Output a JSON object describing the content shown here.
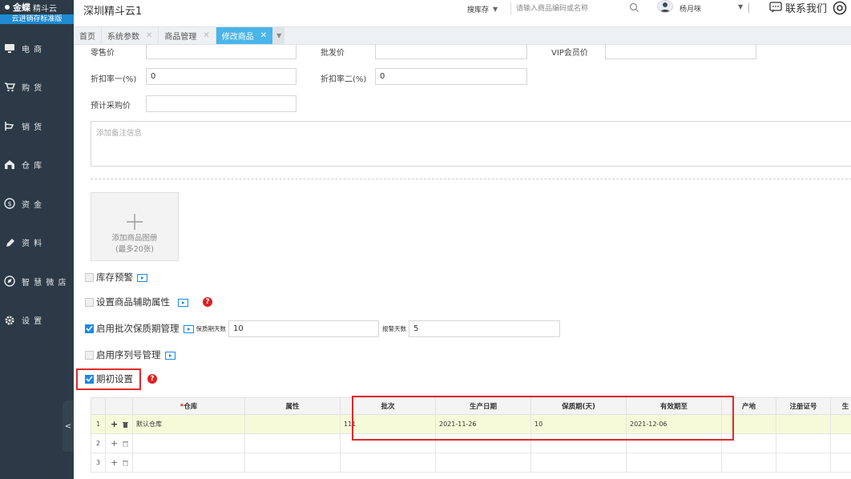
{
  "sidebar": {
    "brand": "金蝶",
    "brand_sub": "精斗云",
    "edition": "云进销存标准版",
    "items": [
      {
        "label": "电 商",
        "icon": "computer-icon"
      },
      {
        "label": "购 货",
        "icon": "cart-icon"
      },
      {
        "label": "销 货",
        "icon": "sales-icon"
      },
      {
        "label": "仓 库",
        "icon": "warehouse-icon"
      },
      {
        "label": "资 金",
        "icon": "money-icon"
      },
      {
        "label": "资 料",
        "icon": "pen-icon"
      },
      {
        "label": "智 慧 微 店",
        "icon": "shop-icon"
      },
      {
        "label": "设 置",
        "icon": "gear-icon"
      }
    ],
    "collapse": "<"
  },
  "header": {
    "title": "深圳精斗云1",
    "search_category": "搜库存",
    "search_placeholder": "请输入商品编码或名称",
    "username": "杨月咪",
    "contact": "联系我们"
  },
  "tabs": [
    {
      "label": "首页",
      "closable": false
    },
    {
      "label": "系统参数",
      "closable": true
    },
    {
      "label": "商品管理",
      "closable": true
    },
    {
      "label": "修改商品",
      "closable": true,
      "active": true
    }
  ],
  "form": {
    "retail_label": "零售价",
    "wholesale_label": "批发价",
    "vip_label": "VIP会员价",
    "discount1_label": "折扣率一(%)",
    "discount1_value": "0",
    "discount2_label": "折扣率二(%)",
    "discount2_value": "0",
    "est_purchase_label": "预计采购价",
    "remark_placeholder": "添加备注信息",
    "album_line1": "添加商品图册",
    "album_line2": "(最多20张)"
  },
  "options": {
    "stock_warning": "库存预警",
    "aux_attr": "设置商品辅助属性",
    "batch_mgmt": "启用批次保质期管理",
    "shelf_days_label": "保质期天数",
    "shelf_days_value": "10",
    "alarm_days_label": "报警天数",
    "alarm_days_value": "5",
    "serial_mgmt": "启用序列号管理",
    "initial_setup": "期初设置"
  },
  "grid": {
    "columns": [
      "",
      "",
      "仓库",
      "属性",
      "批次",
      "生产日期",
      "保质期(天)",
      "有效期至",
      "产地",
      "注册证号",
      "生"
    ],
    "required_col": "仓库",
    "rows": [
      {
        "no": "1",
        "warehouse": "默认仓库",
        "attr": "",
        "batch": "111",
        "prod_date": "2021-11-26",
        "shelf": "10",
        "expire": "2021-12-06",
        "origin": "",
        "reg": "",
        "extra": ""
      },
      {
        "no": "2",
        "warehouse": "",
        "attr": "",
        "batch": "",
        "prod_date": "",
        "shelf": "",
        "expire": "",
        "origin": "",
        "reg": "",
        "extra": ""
      },
      {
        "no": "3",
        "warehouse": "",
        "attr": "",
        "batch": "",
        "prod_date": "",
        "shelf": "",
        "expire": "",
        "origin": "",
        "reg": "",
        "extra": ""
      }
    ]
  },
  "colors": {
    "sidebar_bg": "#2b3a46",
    "accent": "#4ab5e8",
    "checkbox": "#1e88e5",
    "highlight": "#e02a2a",
    "selected_row": "#f6fad9"
  }
}
